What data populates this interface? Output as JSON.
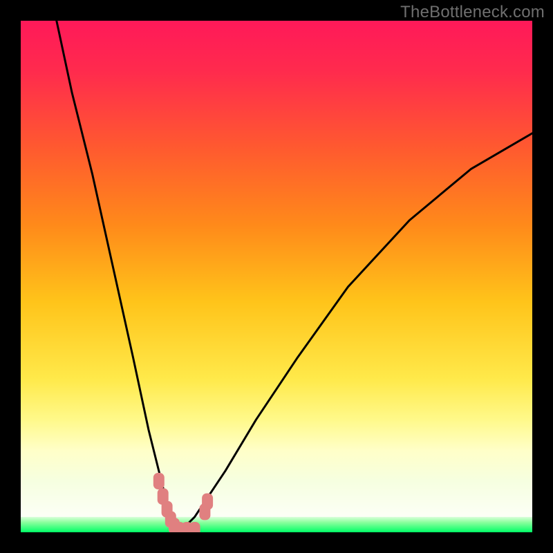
{
  "watermark": "TheBottleneck.com",
  "colors": {
    "frame": "#000000",
    "curve": "#000000",
    "markers": "#e08080",
    "green_band": "#00ff66",
    "gradient_stops": [
      {
        "offset": 0.0,
        "color": "#ff1959"
      },
      {
        "offset": 0.1,
        "color": "#ff2b4d"
      },
      {
        "offset": 0.25,
        "color": "#ff5a2f"
      },
      {
        "offset": 0.4,
        "color": "#ff8a1a"
      },
      {
        "offset": 0.55,
        "color": "#ffc41a"
      },
      {
        "offset": 0.7,
        "color": "#ffe94a"
      },
      {
        "offset": 0.78,
        "color": "#fff98a"
      },
      {
        "offset": 0.84,
        "color": "#ffffc8"
      },
      {
        "offset": 0.9,
        "color": "#f6ffe0"
      },
      {
        "offset": 1.0,
        "color": "#ffffff"
      }
    ]
  },
  "chart_data": {
    "type": "line",
    "title": "",
    "xlabel": "",
    "ylabel": "",
    "xlim": [
      0,
      100
    ],
    "ylim": [
      0,
      100
    ],
    "series": [
      {
        "name": "left-branch",
        "x": [
          7,
          10,
          14,
          18,
          22,
          25,
          27,
          28.5,
          29.5,
          30,
          30.5
        ],
        "y": [
          100,
          86,
          70,
          52,
          34,
          20,
          12,
          6,
          3,
          1,
          0
        ]
      },
      {
        "name": "right-branch",
        "x": [
          30.5,
          32,
          34,
          36,
          40,
          46,
          54,
          64,
          76,
          88,
          100
        ],
        "y": [
          0,
          1,
          3,
          6,
          12,
          22,
          34,
          48,
          61,
          71,
          78
        ]
      }
    ],
    "markers": {
      "name": "highlighted-points",
      "points": [
        {
          "x": 27.0,
          "y": 10.0
        },
        {
          "x": 27.8,
          "y": 7.0
        },
        {
          "x": 28.6,
          "y": 4.5
        },
        {
          "x": 29.3,
          "y": 2.5
        },
        {
          "x": 30.0,
          "y": 1.2
        },
        {
          "x": 31.0,
          "y": 0.4
        },
        {
          "x": 32.5,
          "y": 0.4
        },
        {
          "x": 34.0,
          "y": 0.4
        },
        {
          "x": 36.0,
          "y": 4.0
        },
        {
          "x": 36.5,
          "y": 6.0
        }
      ]
    },
    "bands": [
      {
        "name": "green-band",
        "y0": 0,
        "y1": 3,
        "color": "#00ff66"
      }
    ]
  }
}
